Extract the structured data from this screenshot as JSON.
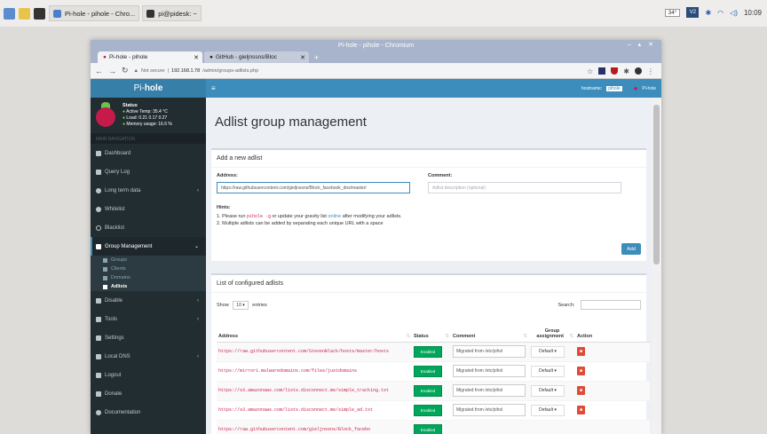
{
  "taskbar": {
    "tasks": [
      "Pi-hole - pihole - Chro...",
      "pi@pidesk: ~"
    ],
    "cpu": "34°",
    "vnc": "V2",
    "time": "10:09"
  },
  "window": {
    "title": "Pi-hole - pihole - Chromium",
    "tabs": [
      {
        "label": "Pi-hole - pihole"
      },
      {
        "label": "GitHub - gieljnssns/Bloc"
      }
    ],
    "address": {
      "security": "Not secure",
      "url_host": "192.168.1.78",
      "url_path": "/admin/groups-adlists.php"
    }
  },
  "sidebar": {
    "logo_pi": "Pi-",
    "logo_hole": "hole",
    "status": {
      "title": "Status",
      "active": "Active",
      "temp": "Temp: 35.4 °C",
      "load": "Load: 0.21 0.17 0.27",
      "memory": "Memory usage: 16.6 %"
    },
    "nav_header": "MAIN NAVIGATION",
    "items": [
      {
        "label": "Dashboard",
        "icon": "home-icon"
      },
      {
        "label": "Query Log",
        "icon": "file-icon"
      },
      {
        "label": "Long term data",
        "icon": "clock-icon"
      },
      {
        "label": "Whitelist",
        "icon": "check-circle-icon"
      },
      {
        "label": "Blacklist",
        "icon": "ban-icon"
      },
      {
        "label": "Group Management",
        "icon": "users-icon"
      }
    ],
    "sub_items": [
      {
        "label": "Groups",
        "icon": "users-icon"
      },
      {
        "label": "Clients",
        "icon": "laptop-icon"
      },
      {
        "label": "Domains",
        "icon": "list-icon"
      },
      {
        "label": "Adlists",
        "icon": "shield-icon"
      }
    ],
    "items_after": [
      {
        "label": "Disable",
        "icon": "stop-icon"
      },
      {
        "label": "Tools",
        "icon": "folder-icon"
      },
      {
        "label": "Settings",
        "icon": "gears-icon"
      },
      {
        "label": "Local DNS",
        "icon": "address-book-icon"
      },
      {
        "label": "Logout",
        "icon": "user-icon"
      },
      {
        "label": "Donate",
        "icon": "paypal-icon"
      },
      {
        "label": "Documentation",
        "icon": "question-icon"
      }
    ]
  },
  "topbar": {
    "menu": "≡",
    "hostname_label": "hostname:",
    "hostname": "pihole",
    "user": "Pi-hole"
  },
  "content": {
    "title": "Adlist group management",
    "add_box": {
      "title": "Add a new adlist",
      "address_label": "Address:",
      "address_value": "https://raw.githubusercontent.com/gieljnssns/Block_facebook_dns/master/",
      "comment_label": "Comment:",
      "comment_placeholder": "Adlist description (optional)",
      "hints_title": "Hints:",
      "hint1_pre": "1. Please run",
      "hint1_code": "pihole -g",
      "hint1_mid": "or update your gravity list",
      "hint1_link": "online",
      "hint1_post": "after modifying your adlists.",
      "hint2": "2. Multiple adlists can be added by separating each unique URL with a space",
      "add_button": "Add"
    },
    "list_box": {
      "title": "List of configured adlists",
      "show": "Show",
      "entries_value": "10",
      "entries": "entries",
      "search": "Search:",
      "columns": [
        "Address",
        "Status",
        "Comment",
        "Group assignment",
        "Action"
      ],
      "rows": [
        {
          "address": "https://raw.githubusercontent.com/StevenBlack/hosts/master/hosts",
          "status": "Enabled",
          "comment": "Migrated from /etc/pihol",
          "group": "Default ▾"
        },
        {
          "address": "https://mirror1.malwaredomains.com/files/justdomains",
          "status": "Enabled",
          "comment": "Migrated from /etc/pihol",
          "group": "Default ▾"
        },
        {
          "address": "https://s3.amazonaws.com/lists.disconnect.me/simple_tracking.txt",
          "status": "Enabled",
          "comment": "Migrated from /etc/pihol",
          "group": "Default ▾"
        },
        {
          "address": "https://s3.amazonaws.com/lists.disconnect.me/simple_ad.txt",
          "status": "Enabled",
          "comment": "Migrated from /etc/pihol",
          "group": "Default ▾"
        },
        {
          "address": "https://raw.githubusercontent.com/gieljnssns/Block_facebo",
          "status": "Enabled",
          "comment": "",
          "group": ""
        }
      ]
    }
  },
  "colors": {
    "accent": "#3c8dbc",
    "sidebar": "#222d32",
    "enabled": "#00a65a",
    "delete": "#dd4b39"
  }
}
